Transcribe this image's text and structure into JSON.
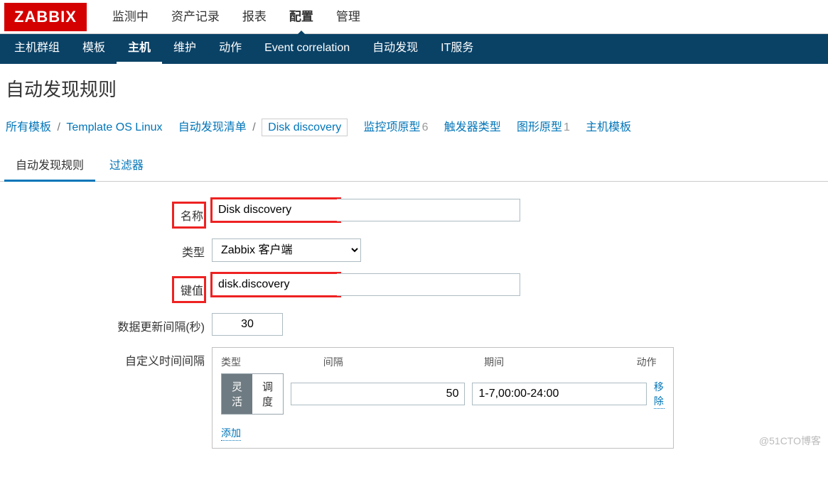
{
  "logo": "ZABBIX",
  "topnav": {
    "items": [
      "监测中",
      "资产记录",
      "报表",
      "配置",
      "管理"
    ],
    "active": "配置"
  },
  "subnav": {
    "items": [
      "主机群组",
      "模板",
      "主机",
      "维护",
      "动作",
      "Event correlation",
      "自动发现",
      "IT服务"
    ],
    "active": "主机"
  },
  "page_title": "自动发现规则",
  "breadcrumb": {
    "all_templates": "所有模板",
    "template_name": "Template OS Linux",
    "discovery_list": "自动发现清单",
    "current": "Disk discovery",
    "items_proto": "监控项原型",
    "items_count": "6",
    "triggers_proto": "触发器类型",
    "graphs_proto": "图形原型",
    "graphs_count": "1",
    "host_proto": "主机模板"
  },
  "tabs": {
    "rule": "自动发现规则",
    "filter": "过滤器"
  },
  "form": {
    "name_label": "名称",
    "name_value": "Disk discovery",
    "type_label": "类型",
    "type_value": "Zabbix 客户端",
    "key_label": "键值",
    "key_value": "disk.discovery",
    "interval_label": "数据更新间隔(秒)",
    "interval_value": "30",
    "custom_label": "自定义时间间隔",
    "headers": {
      "type": "类型",
      "interval": "间隔",
      "period": "期间",
      "action": "动作"
    },
    "seg_flex": "灵活",
    "seg_sched": "调度",
    "int_val": "50",
    "per_val": "1-7,00:00-24:00",
    "remove": "移除",
    "add": "添加"
  },
  "watermark": "@51CTO博客"
}
